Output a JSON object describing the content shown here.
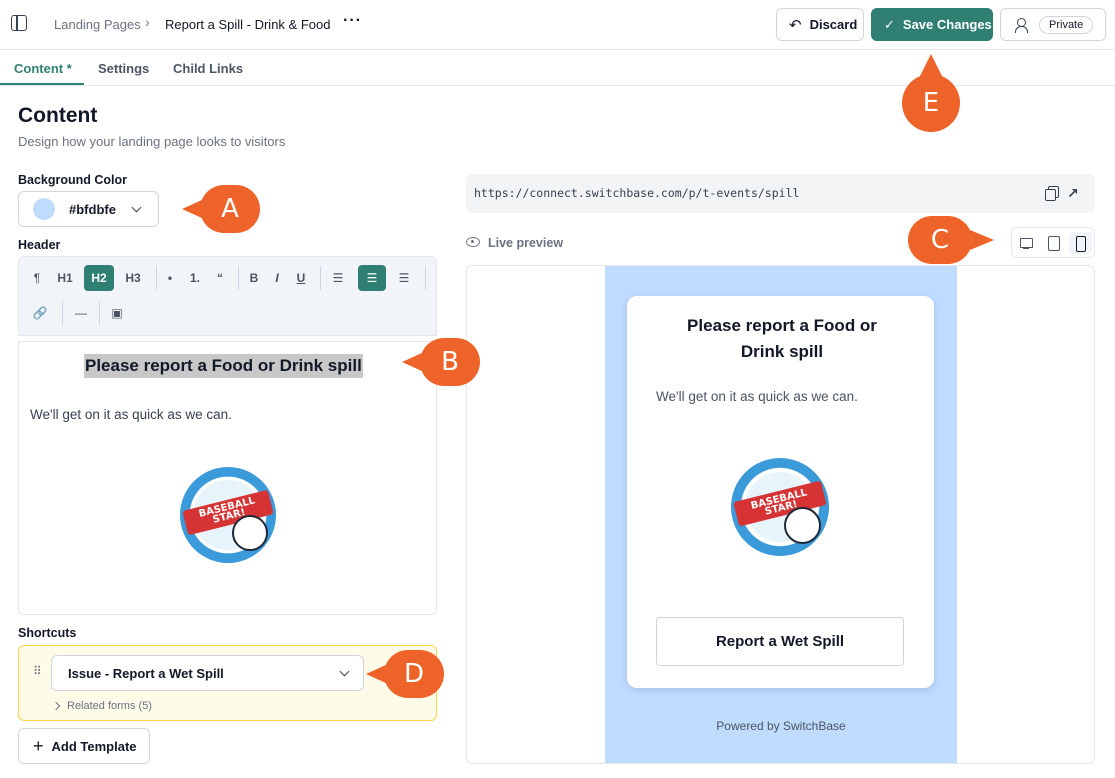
{
  "breadcrumb": {
    "root": "Landing Pages",
    "separator": "›",
    "current": "Report a Spill - Drink & Food",
    "more": "···"
  },
  "actions": {
    "discard_icon": "undo-icon",
    "discard_label": "Discard",
    "save_icon": "check-icon",
    "save_label": "Save Changes",
    "private_label": "Private"
  },
  "tabs": [
    {
      "label": "Content *",
      "active": true
    },
    {
      "label": "Settings",
      "active": false
    },
    {
      "label": "Child Links",
      "active": false
    }
  ],
  "content": {
    "title": "Content",
    "subtitle": "Design how your landing page looks to visitors"
  },
  "background": {
    "label": "Background Color",
    "value": "#bfdbfe"
  },
  "header": {
    "label": "Header",
    "toolbar": [
      "¶",
      "H1",
      "H2",
      "H3",
      "•",
      "1.",
      "“",
      "B",
      "I",
      "U"
    ],
    "heading": "Please report a Food or Drink spill",
    "paragraph": "We'll get on it as quick as we can.",
    "badge_text": "BASEBALL STAR!"
  },
  "shortcuts": {
    "label": "Shortcuts",
    "selected": "Issue - Report a Wet Spill",
    "related": "Related forms (5)",
    "add_label": "Add Template"
  },
  "preview": {
    "url": "https://connect.switchbase.com/p/t-events/spill",
    "label": "Live preview",
    "heading": "Please report a Food or Drink spill",
    "paragraph": "We'll get on it as quick as we can.",
    "button": "Report a Wet Spill",
    "powered": "Powered by SwitchBase"
  },
  "callouts": {
    "a": "A",
    "b": "B",
    "c": "C",
    "d": "D",
    "e": "E"
  },
  "colors": {
    "accent": "#2f7f73",
    "callout": "#ee6329",
    "preview_bg": "#bfdbfe"
  }
}
